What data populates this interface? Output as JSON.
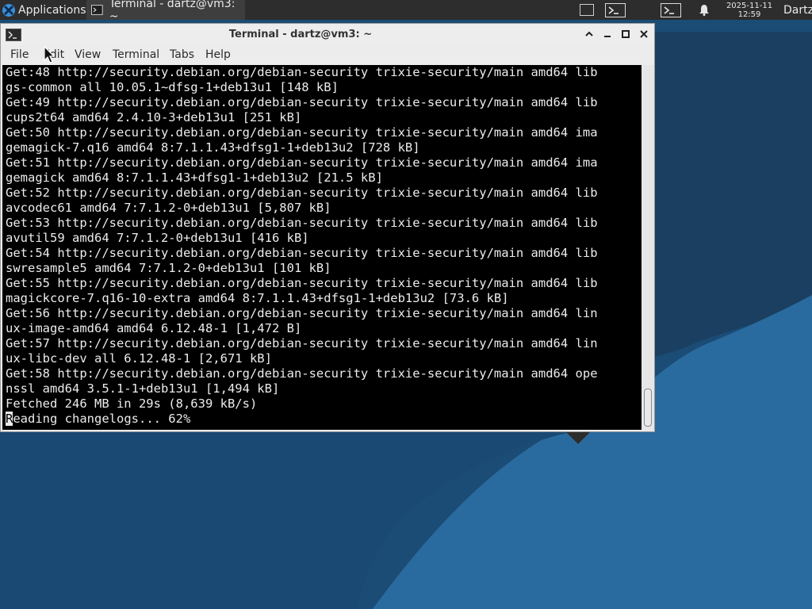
{
  "top_panel": {
    "applications_label": "Applications",
    "taskbar_title": "Terminal - dartz@vm3: ~",
    "clock_date": "2025-11-11",
    "clock_time": "12:59",
    "user_label": "Dartz"
  },
  "window": {
    "title": "Terminal - dartz@vm3: ~",
    "menu": [
      "File",
      "Edit",
      "View",
      "Terminal",
      "Tabs",
      "Help"
    ]
  },
  "terminal": {
    "lines": [
      "Get:48 http://security.debian.org/debian-security trixie-security/main amd64 lib",
      "gs-common all 10.05.1~dfsg-1+deb13u1 [148 kB]",
      "Get:49 http://security.debian.org/debian-security trixie-security/main amd64 lib",
      "cups2t64 amd64 2.4.10-3+deb13u1 [251 kB]",
      "Get:50 http://security.debian.org/debian-security trixie-security/main amd64 ima",
      "gemagick-7.q16 amd64 8:7.1.1.43+dfsg1-1+deb13u2 [728 kB]",
      "Get:51 http://security.debian.org/debian-security trixie-security/main amd64 ima",
      "gemagick amd64 8:7.1.1.43+dfsg1-1+deb13u2 [21.5 kB]",
      "Get:52 http://security.debian.org/debian-security trixie-security/main amd64 lib",
      "avcodec61 amd64 7:7.1.2-0+deb13u1 [5,807 kB]",
      "Get:53 http://security.debian.org/debian-security trixie-security/main amd64 lib",
      "avutil59 amd64 7:7.1.2-0+deb13u1 [416 kB]",
      "Get:54 http://security.debian.org/debian-security trixie-security/main amd64 lib",
      "swresample5 amd64 7:7.1.2-0+deb13u1 [101 kB]",
      "Get:55 http://security.debian.org/debian-security trixie-security/main amd64 lib",
      "magickcore-7.q16-10-extra amd64 8:7.1.1.43+dfsg1-1+deb13u2 [73.6 kB]",
      "Get:56 http://security.debian.org/debian-security trixie-security/main amd64 lin",
      "ux-image-amd64 amd64 6.12.48-1 [1,472 B]",
      "Get:57 http://security.debian.org/debian-security trixie-security/main amd64 lin",
      "ux-libc-dev all 6.12.48-1 [2,671 kB]",
      "Get:58 http://security.debian.org/debian-security trixie-security/main amd64 ope",
      "nssl amd64 3.5.1-1+deb13u1 [1,494 kB]",
      "Fetched 246 MB in 29s (8,639 kB/s)"
    ],
    "last_line_cursor_char": "R",
    "last_line_rest": "eading changelogs... 62%"
  },
  "colors": {
    "desktop_dark": "#1b4f7a",
    "desktop_light": "#2a6fa3",
    "panel": "#2d2d2d",
    "terminal_bg": "#000000",
    "terminal_fg": "#ececec"
  }
}
